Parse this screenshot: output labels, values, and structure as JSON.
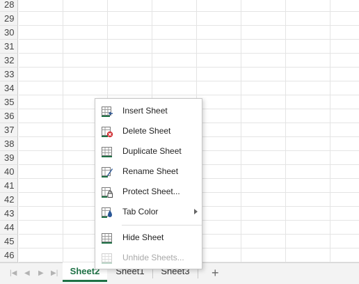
{
  "rows": [
    "28",
    "29",
    "30",
    "31",
    "32",
    "33",
    "34",
    "35",
    "36",
    "37",
    "38",
    "39",
    "40",
    "41",
    "42",
    "43",
    "44",
    "45",
    "46"
  ],
  "context_menu": {
    "items": [
      {
        "label": "Insert Sheet",
        "icon": "insert-sheet-icon"
      },
      {
        "label": "Delete Sheet",
        "icon": "delete-sheet-icon"
      },
      {
        "label": "Duplicate Sheet",
        "icon": "duplicate-sheet-icon"
      },
      {
        "label": "Rename Sheet",
        "icon": "rename-sheet-icon"
      },
      {
        "label": "Protect Sheet...",
        "icon": "protect-sheet-icon"
      },
      {
        "label": "Tab Color",
        "icon": "tab-color-icon"
      },
      {
        "label": "Hide Sheet",
        "icon": "hide-sheet-icon"
      },
      {
        "label": "Unhide Sheets...",
        "icon": "unhide-sheets-icon"
      }
    ]
  },
  "sheet_tabs": {
    "tabs": [
      "Sheet2",
      "Sheet1",
      "Sheet3"
    ],
    "active": "Sheet2",
    "add_icon": "+"
  },
  "colors": {
    "accent": "#1e7145",
    "delete": "#d13438",
    "icon_blue": "#2b5797"
  }
}
